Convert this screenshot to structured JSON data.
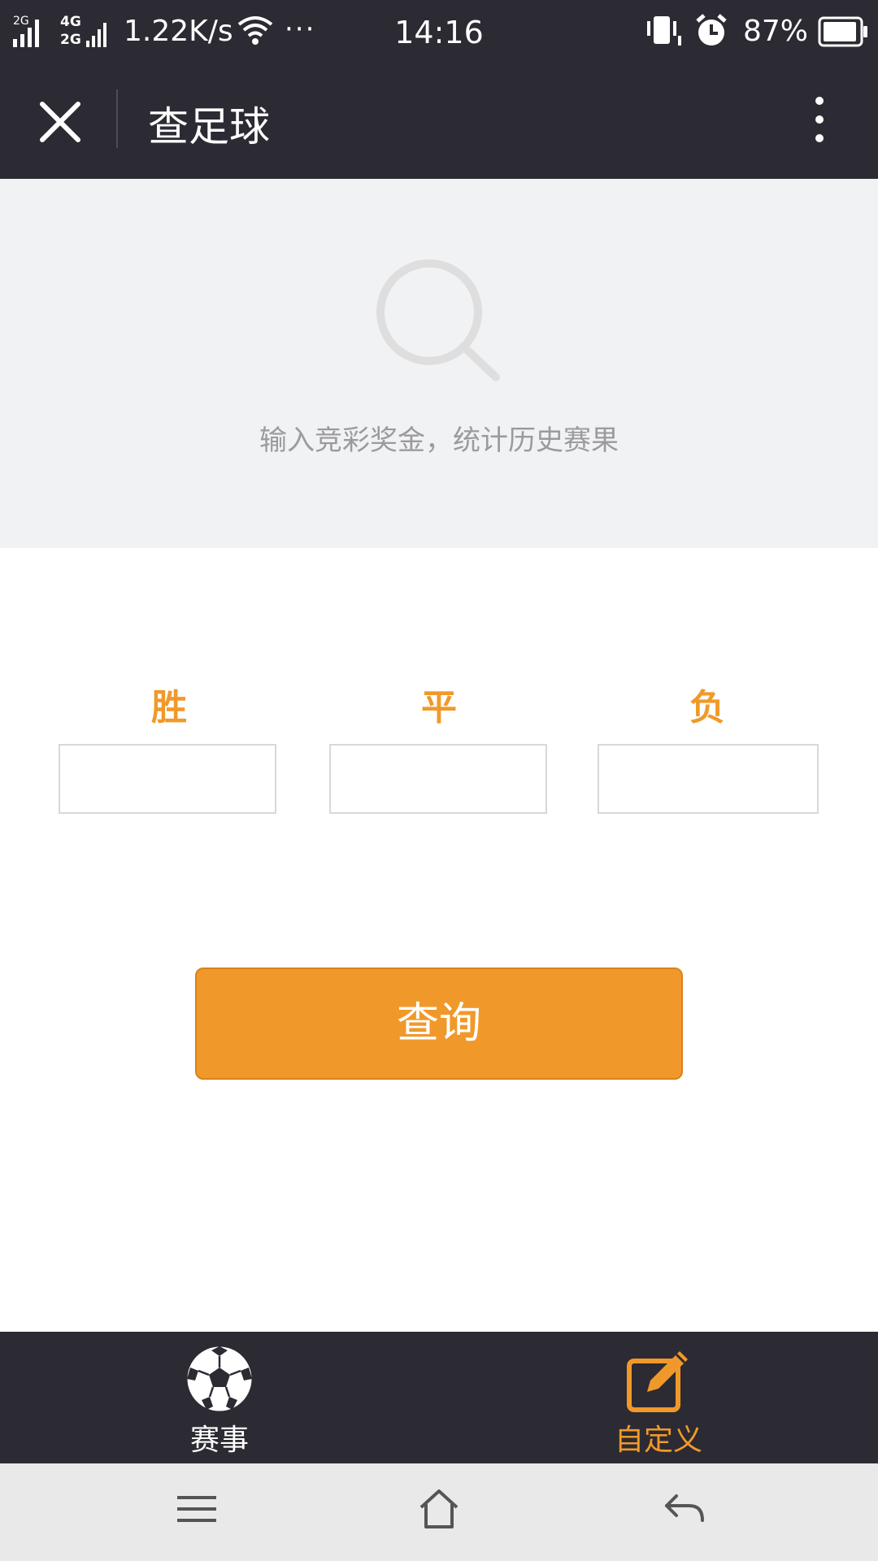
{
  "status_bar": {
    "network_top": "2G",
    "network_mid": "4G",
    "network_bottom": "2G",
    "speed": "1.22K/s",
    "more": "···",
    "time": "14:16",
    "battery": "87%"
  },
  "header": {
    "title": "查足球",
    "close_icon": "close-icon",
    "more_icon": "more-vertical-icon"
  },
  "hero": {
    "icon": "search-icon",
    "hint": "输入竞彩奖金，统计历史赛果"
  },
  "odds": {
    "win_label": "胜",
    "draw_label": "平",
    "lose_label": "负",
    "win_value": "",
    "draw_value": "",
    "lose_value": ""
  },
  "query_button": "查询",
  "tabs": [
    {
      "label": "赛事",
      "icon": "soccer-ball-icon",
      "active": false
    },
    {
      "label": "自定义",
      "icon": "edit-icon",
      "active": true
    }
  ],
  "colors": {
    "accent": "#f0992a",
    "header_bg": "#2c2b33",
    "hero_bg": "#f1f2f4",
    "hint_text": "#9b9b9b",
    "nav_bg": "#e9e9e9"
  }
}
